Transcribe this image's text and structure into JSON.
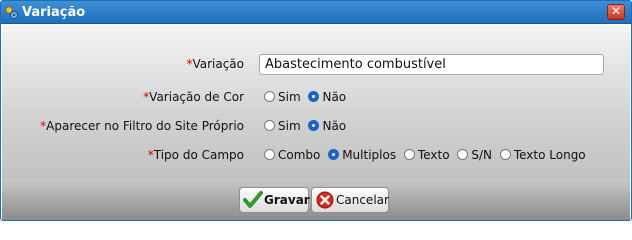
{
  "window": {
    "title": "Variação",
    "close_label": "✕"
  },
  "form": {
    "required_mark": "*",
    "variacao": {
      "label": "Variação",
      "value": "Abastecimento combustível"
    },
    "variacao_cor": {
      "label": "Variação de Cor",
      "options": [
        "Sim",
        "Não"
      ],
      "selected": "Não"
    },
    "filtro_site": {
      "label": "Aparecer no Filtro do Site Próprio",
      "options": [
        "Sim",
        "Não"
      ],
      "selected": "Não"
    },
    "tipo_campo": {
      "label": "Tipo do Campo",
      "options": [
        "Combo",
        "Multiplos",
        "Texto",
        "S/N",
        "Texto Longo"
      ],
      "selected": "Multiplos"
    }
  },
  "footer": {
    "save_label": "Gravar",
    "cancel_label": "Cancelar"
  },
  "icons": {
    "app": "app-icon",
    "close": "close-icon",
    "save": "check-icon",
    "cancel": "cancel-icon"
  },
  "colors": {
    "titlebar": "#2a7fc8",
    "required": "#d40000",
    "radio_selected": "#1a64c4"
  }
}
